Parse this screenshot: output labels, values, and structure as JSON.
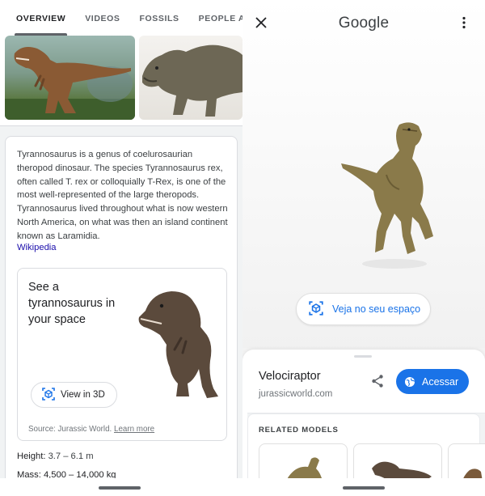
{
  "left": {
    "tabs": [
      {
        "label": "OVERVIEW",
        "active": true
      },
      {
        "label": "VIDEOS",
        "active": false
      },
      {
        "label": "FOSSILS",
        "active": false
      },
      {
        "label": "PEOPLE ALSO SEARCH FOR",
        "active": false
      }
    ],
    "description": "Tyrannosaurus is a genus of coelurosaurian theropod dinosaur. The species Tyrannosaurus rex, often called T. rex or colloquially T-Rex, is one of the most well-represented of the large theropods. Tyrannosaurus lived throughout what is now western North America, on what was then an island continent known as Laramidia.",
    "wiki_link": "Wikipedia",
    "ar_card": {
      "title": "See a tyrannosaurus in your space",
      "button_label": "View in 3D",
      "source_prefix": "Source: Jurassic World.",
      "learn_more": "Learn more"
    },
    "height_label": "Height:",
    "height_value": "3.7 – 6.1 m",
    "mass_label": "Mass:",
    "mass_value": "4,500 – 14,000 kg"
  },
  "right": {
    "brand": "Google",
    "veja_label": "Veja no seu espaço",
    "model_name": "Velociraptor",
    "model_source": "jurassicworld.com",
    "acessar_label": "Acessar",
    "related_label": "RELATED MODELS"
  },
  "colors": {
    "accent_blue": "#1a73e8",
    "link_blue": "#1a0dab",
    "text_primary": "#202124",
    "text_secondary": "#70757a"
  },
  "icons": [
    "close-icon",
    "more-vert-icon",
    "ar-cube-icon",
    "share-icon",
    "globe-icon"
  ]
}
